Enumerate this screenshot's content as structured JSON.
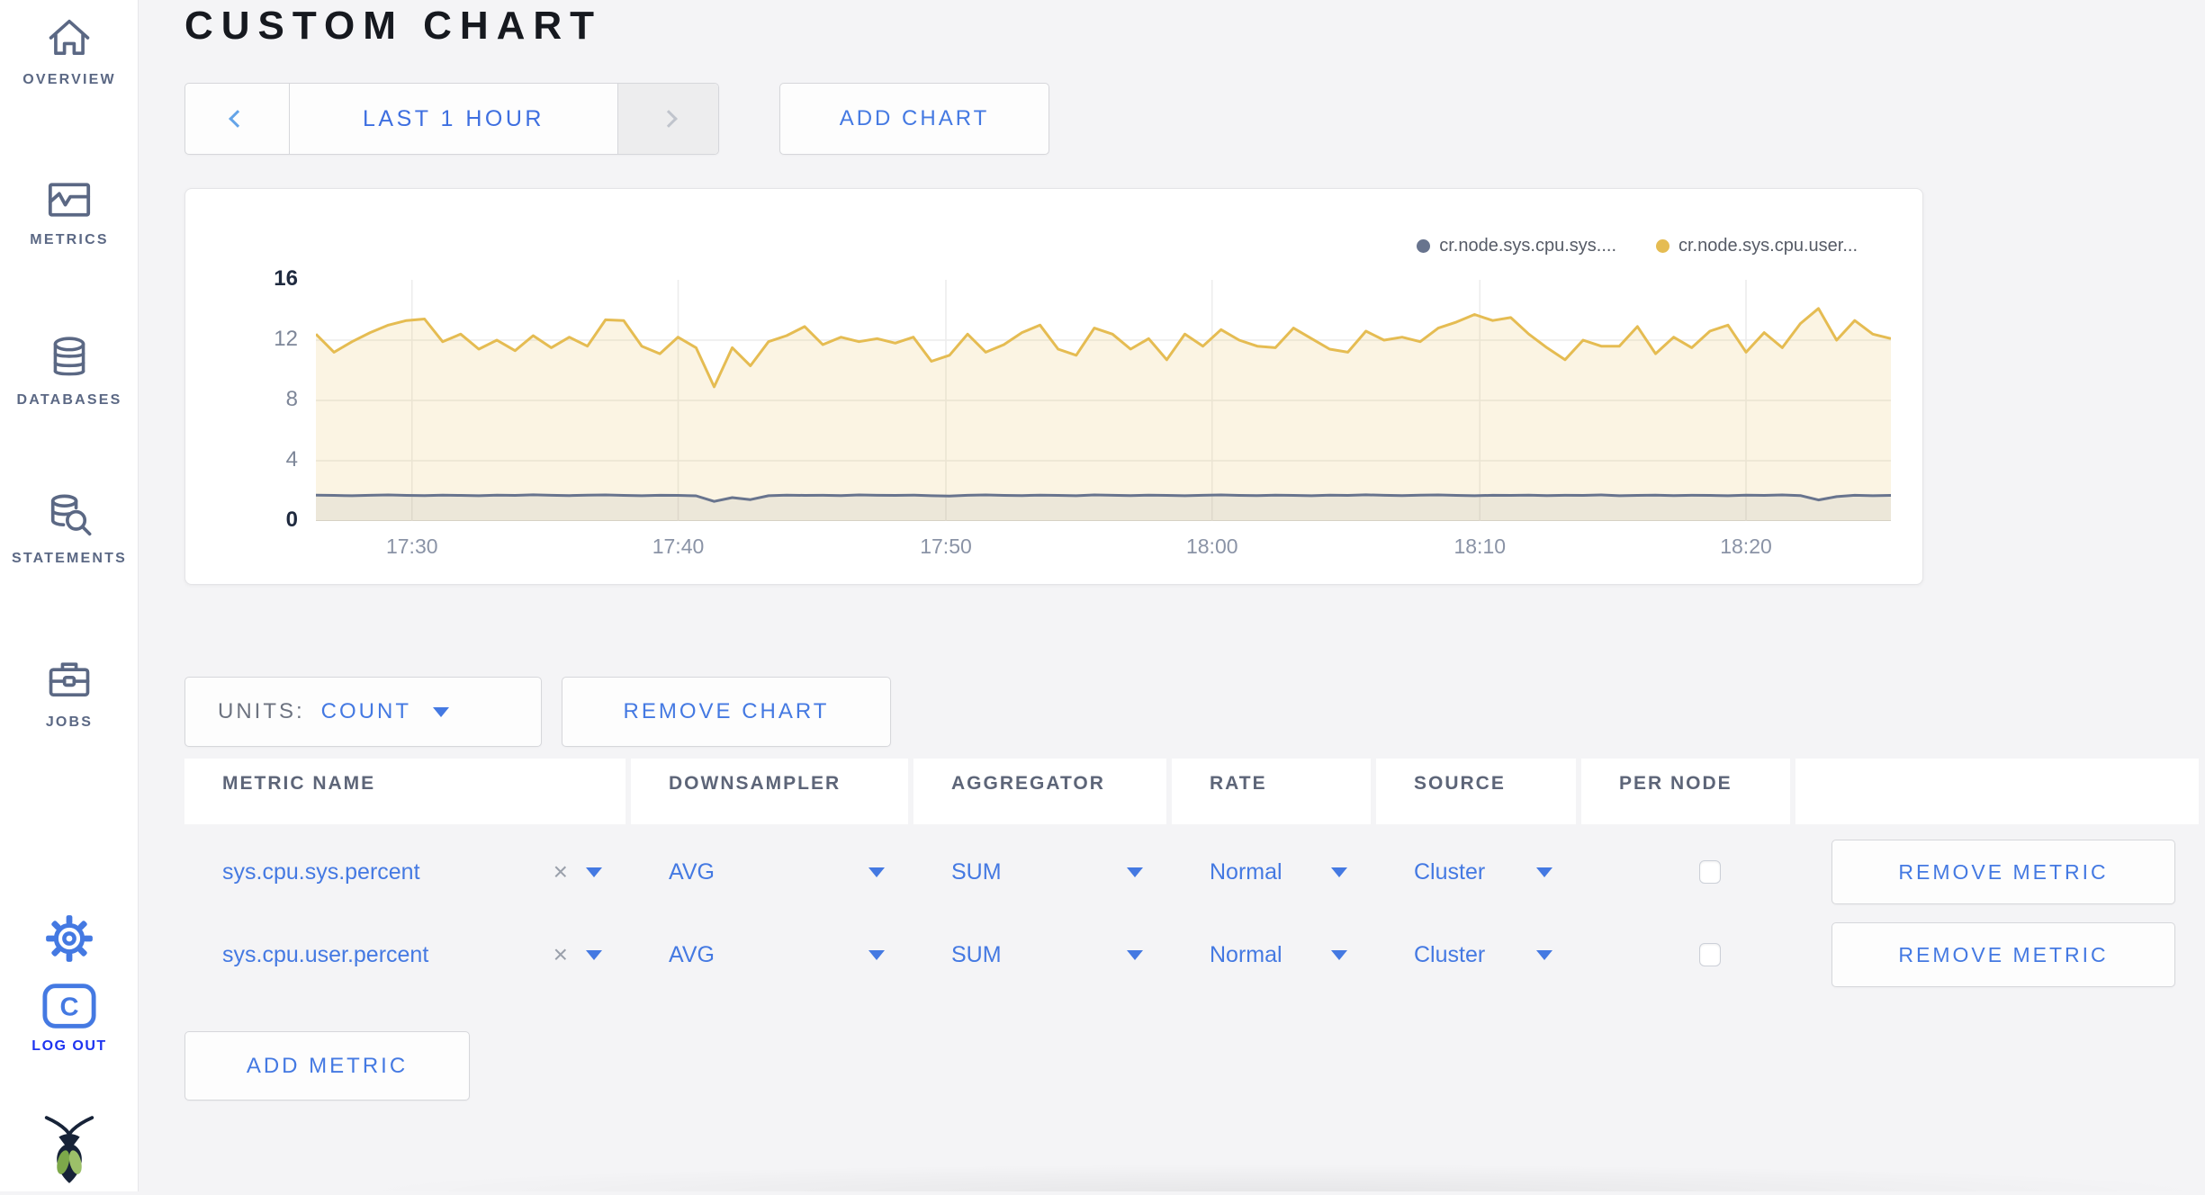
{
  "colors": {
    "accent_blue": "#4479e2",
    "logout_blue": "#1d33f0",
    "sidebar_text": "#5b6884",
    "page_bg": "#f4f4f6",
    "card_bg": "#ffffff",
    "series_sys_color": "#68748e",
    "series_user_color": "#e5bc52"
  },
  "sidebar": {
    "items": [
      {
        "label": "OVERVIEW",
        "icon": "home-icon"
      },
      {
        "label": "METRICS",
        "icon": "metrics-icon"
      },
      {
        "label": "DATABASES",
        "icon": "database-icon"
      },
      {
        "label": "STATEMENTS",
        "icon": "statements-icon"
      },
      {
        "label": "JOBS",
        "icon": "jobs-icon"
      }
    ],
    "settings_icon": "gear-icon",
    "logout": {
      "label": "LOG OUT",
      "icon": "cockroach-c-icon"
    },
    "logo_icon": "cockroachdb-bug-icon"
  },
  "header": {
    "title": "CUSTOM CHART",
    "time_selector": {
      "prev": "previous-timewindow",
      "label": "LAST 1 HOUR",
      "next": "next-timewindow"
    },
    "add_chart": "ADD CHART"
  },
  "chart_data": {
    "type": "line",
    "title": "",
    "xlabel": "",
    "ylabel": "",
    "ylim": [
      0,
      16
    ],
    "y_ticks": [
      0,
      4,
      8,
      12,
      16
    ],
    "y_gridlines": [
      4,
      8,
      12
    ],
    "grid": true,
    "legend_position": "top-right",
    "x_ticks": [
      {
        "label": "17:30",
        "frac": 0.061
      },
      {
        "label": "17:40",
        "frac": 0.23
      },
      {
        "label": "17:50",
        "frac": 0.4
      },
      {
        "label": "18:00",
        "frac": 0.569
      },
      {
        "label": "18:10",
        "frac": 0.739
      },
      {
        "label": "18:20",
        "frac": 0.908
      }
    ],
    "series": [
      {
        "name": "cr.node.sys.cpu.sys....",
        "color": "#68748e",
        "fill": "rgba(104,116,142,0.10)",
        "values": [
          1.72,
          1.7,
          1.68,
          1.71,
          1.73,
          1.7,
          1.69,
          1.72,
          1.7,
          1.68,
          1.72,
          1.7,
          1.74,
          1.71,
          1.69,
          1.72,
          1.73,
          1.7,
          1.68,
          1.71,
          1.7,
          1.67,
          1.3,
          1.55,
          1.42,
          1.68,
          1.72,
          1.7,
          1.71,
          1.69,
          1.73,
          1.71,
          1.7,
          1.72,
          1.68,
          1.66,
          1.71,
          1.73,
          1.7,
          1.69,
          1.72,
          1.7,
          1.68,
          1.73,
          1.71,
          1.69,
          1.72,
          1.7,
          1.68,
          1.71,
          1.73,
          1.7,
          1.69,
          1.72,
          1.7,
          1.68,
          1.72,
          1.7,
          1.74,
          1.71,
          1.69,
          1.72,
          1.73,
          1.7,
          1.68,
          1.71,
          1.7,
          1.72,
          1.69,
          1.71,
          1.7,
          1.73,
          1.68,
          1.7,
          1.72,
          1.69,
          1.71,
          1.7,
          1.68,
          1.72,
          1.7,
          1.73,
          1.69,
          1.4,
          1.62,
          1.71,
          1.68,
          1.7
        ]
      },
      {
        "name": "cr.node.sys.cpu.user...",
        "color": "#e5bc52",
        "fill": "rgba(229,188,82,0.16)",
        "values": [
          12.4,
          11.2,
          11.9,
          12.5,
          13.0,
          13.3,
          13.4,
          11.9,
          12.4,
          11.4,
          12.0,
          11.3,
          12.3,
          11.5,
          12.2,
          11.6,
          13.35,
          13.3,
          11.6,
          11.1,
          12.2,
          11.5,
          8.9,
          11.5,
          10.3,
          11.9,
          12.3,
          12.9,
          11.7,
          12.2,
          11.9,
          12.1,
          11.8,
          12.2,
          10.6,
          11.0,
          12.4,
          11.2,
          11.7,
          12.5,
          13.0,
          11.4,
          11.0,
          12.8,
          12.4,
          11.4,
          12.1,
          10.7,
          12.4,
          11.6,
          12.7,
          12.0,
          11.6,
          11.5,
          12.8,
          12.1,
          11.4,
          11.2,
          12.6,
          12.0,
          12.2,
          11.9,
          12.8,
          13.2,
          13.7,
          13.3,
          13.5,
          12.4,
          11.5,
          10.7,
          12.0,
          11.6,
          11.6,
          12.9,
          11.1,
          12.2,
          11.5,
          12.6,
          13.0,
          11.2,
          12.5,
          11.5,
          13.1,
          14.1,
          12.0,
          13.3,
          12.4,
          12.1
        ]
      }
    ]
  },
  "chart_controls": {
    "units_label": "UNITS:",
    "units_value": "COUNT",
    "remove_chart": "REMOVE CHART"
  },
  "metrics_table": {
    "headers": [
      "METRIC NAME",
      "DOWNSAMPLER",
      "AGGREGATOR",
      "RATE",
      "SOURCE",
      "PER NODE"
    ],
    "rows": [
      {
        "metric": "sys.cpu.sys.percent",
        "clear": "×",
        "downsampler": "AVG",
        "aggregator": "SUM",
        "rate": "Normal",
        "source": "Cluster",
        "per_node_checked": false,
        "remove": "REMOVE METRIC"
      },
      {
        "metric": "sys.cpu.user.percent",
        "clear": "×",
        "downsampler": "AVG",
        "aggregator": "SUM",
        "rate": "Normal",
        "source": "Cluster",
        "per_node_checked": false,
        "remove": "REMOVE METRIC"
      }
    ],
    "add_metric": "ADD METRIC"
  }
}
